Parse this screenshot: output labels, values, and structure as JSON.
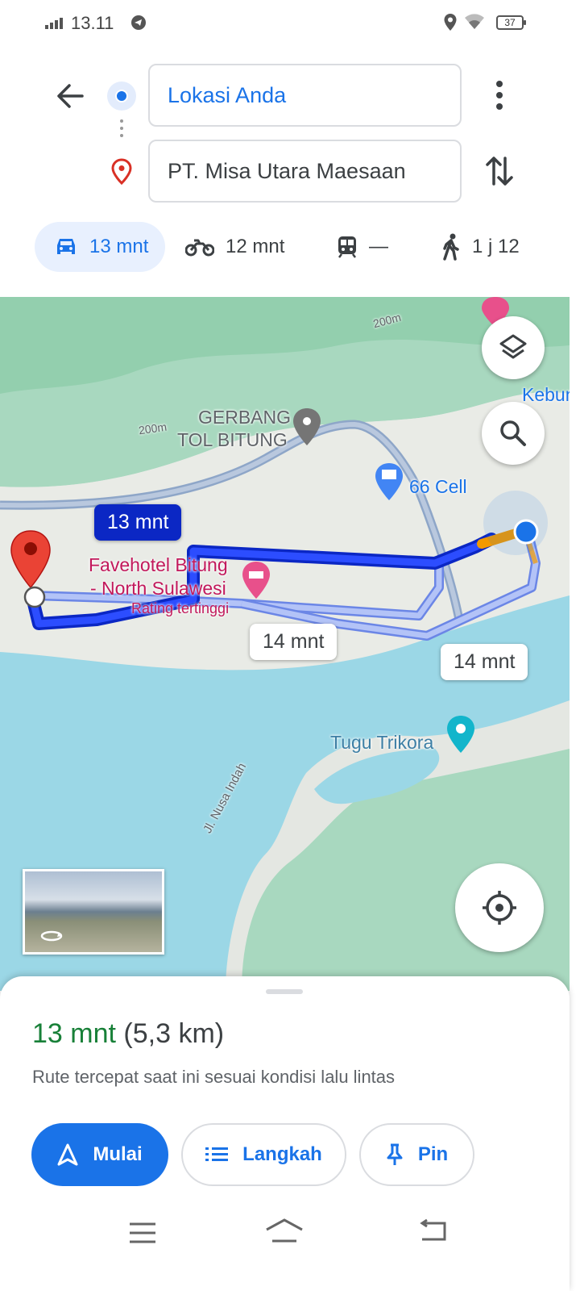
{
  "status_bar": {
    "time": "13.11",
    "battery": "37",
    "icons": [
      "signal-icon",
      "telegram-icon",
      "location-icon",
      "wifi-icon",
      "battery-icon"
    ]
  },
  "directions": {
    "origin": "Lokasi Anda",
    "destination": "PT. Misa Utara Maesaan"
  },
  "modes": [
    {
      "name": "car",
      "label": "13 mnt",
      "active": true
    },
    {
      "name": "motorcycle",
      "label": "12 mnt",
      "active": false
    },
    {
      "name": "transit",
      "label": "—",
      "active": false
    },
    {
      "name": "walk",
      "label": "1 j 12",
      "active": false
    }
  ],
  "map": {
    "labels": {
      "gerbang_line1": "GERBANG",
      "gerbang_line2": "TOL BITUNG",
      "cell": "66 Cell",
      "hotel_line1": "Favehotel Bitung",
      "hotel_line2": "- North Sulawesi",
      "hotel_rating": "Rating tertinggi",
      "tugu": "Tugu Trikora",
      "street": "Jl. Nusa Indah",
      "kebun": "Kebun",
      "elev1": "200m",
      "elev2": "200m"
    },
    "route_badges": {
      "primary": "13 mnt",
      "alt1": "14 mnt",
      "alt2": "14 mnt"
    },
    "colors": {
      "water": "#9bd7e6",
      "land": "#e9ebe6",
      "green": "#a9d9bd",
      "route": "#0b27c4",
      "alt_route": "#a8b8f5",
      "traffic": "#f29900"
    }
  },
  "sheet": {
    "duration": "13 mnt",
    "distance": "(5,3 km)",
    "subtitle": "Rute tercepat saat ini sesuai kondisi lalu lintas",
    "buttons": {
      "start": "Mulai",
      "steps": "Langkah",
      "pin": "Pin"
    }
  }
}
